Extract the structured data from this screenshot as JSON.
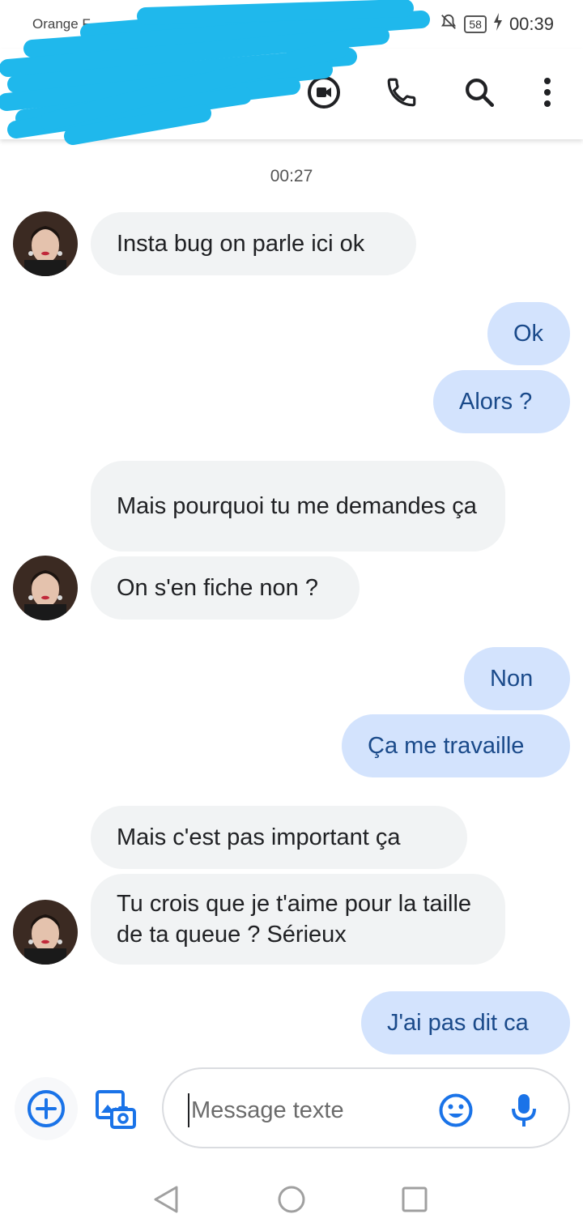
{
  "status_bar": {
    "carrier": "Orange F",
    "battery": "58",
    "time": "00:39"
  },
  "app_bar": {
    "icons": [
      "video-call-icon",
      "phone-icon",
      "search-icon",
      "more-vert-icon"
    ],
    "redaction_color": "#1fb8ec"
  },
  "conversation": {
    "timestamp": "00:27",
    "messages": [
      {
        "direction": "in",
        "text": "Insta bug on parle ici ok"
      },
      {
        "direction": "out",
        "text": "Ok"
      },
      {
        "direction": "out",
        "text": "Alors ?"
      },
      {
        "direction": "in",
        "text": "Mais pourquoi tu me demandes ça"
      },
      {
        "direction": "in",
        "text": "On s'en fiche non ?"
      },
      {
        "direction": "out",
        "text": "Non"
      },
      {
        "direction": "out",
        "text": "Ça me travaille"
      },
      {
        "direction": "in",
        "text": "Mais c'est pas important ça"
      },
      {
        "direction": "in",
        "text": "Tu crois que je t'aime pour la taille de ta queue ? Sérieux"
      },
      {
        "direction": "out",
        "text": "J'ai pas dit ca"
      }
    ]
  },
  "compose": {
    "placeholder": "Message texte",
    "accent": "#1a73e8"
  },
  "colors": {
    "incoming_bubble": "#f1f3f4",
    "outgoing_bubble": "#d3e3fd",
    "outgoing_text": "#1a4a8a"
  }
}
